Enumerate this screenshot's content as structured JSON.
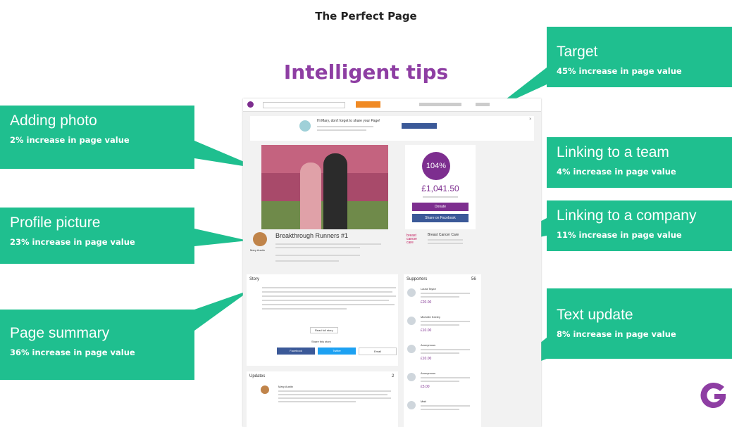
{
  "header": {
    "title": "The Perfect Page",
    "subtitle": "Intelligent tips"
  },
  "callouts": {
    "adding_photo": {
      "label": "Adding photo",
      "stat": "2% increase in page value"
    },
    "profile_picture": {
      "label": "Profile picture",
      "stat": "23% increase in page value"
    },
    "page_summary": {
      "label": "Page summary",
      "stat": "36% increase in page value"
    },
    "target": {
      "label": "Target",
      "stat": "45% increase in page value"
    },
    "linking_team": {
      "label": "Linking to a team",
      "stat": "4% increase in page value"
    },
    "linking_company": {
      "label": "Linking to a company",
      "stat": "11% increase in page value"
    },
    "text_update": {
      "label": "Text update",
      "stat": "8% increase in page value"
    }
  },
  "mock": {
    "notice_text": "Hi Mary, don't forget to share your Page!",
    "target_percent": "104%",
    "amount": "£1,041.50",
    "donate_label": "Donate",
    "share_label": "Share on Facebook",
    "page_title": "Breakthrough Runners #1",
    "owner_name": "Mary Austin",
    "charity_name": "Breast Cancer Care",
    "charity_logo_text": "breast cancer care",
    "story_heading": "Story",
    "read_full_label": "Read full story",
    "share_story_label": "Share this story",
    "facebook_label": "Facebook",
    "twitter_label": "Twitter",
    "email_label": "Email",
    "supporters_heading": "Supporters",
    "supporters_count": "56",
    "supporters": [
      {
        "name": "Laura Taylor",
        "amount": "£20.00"
      },
      {
        "name": "Michelle Keeley",
        "amount": "£10.00"
      },
      {
        "name": "Anonymous",
        "amount": "£10.00"
      },
      {
        "name": "Anonymous",
        "amount": "£5.00"
      },
      {
        "name": "Matt",
        "amount": ""
      }
    ],
    "updates_heading": "Updates",
    "updates_count": "2",
    "update_author": "Mary Austin"
  },
  "colors": {
    "callout": "#1fbf8f",
    "accent_purple": "#8e3ea3",
    "donate": "#7d2e8f",
    "facebook": "#3b5998",
    "twitter": "#1da1f2"
  }
}
